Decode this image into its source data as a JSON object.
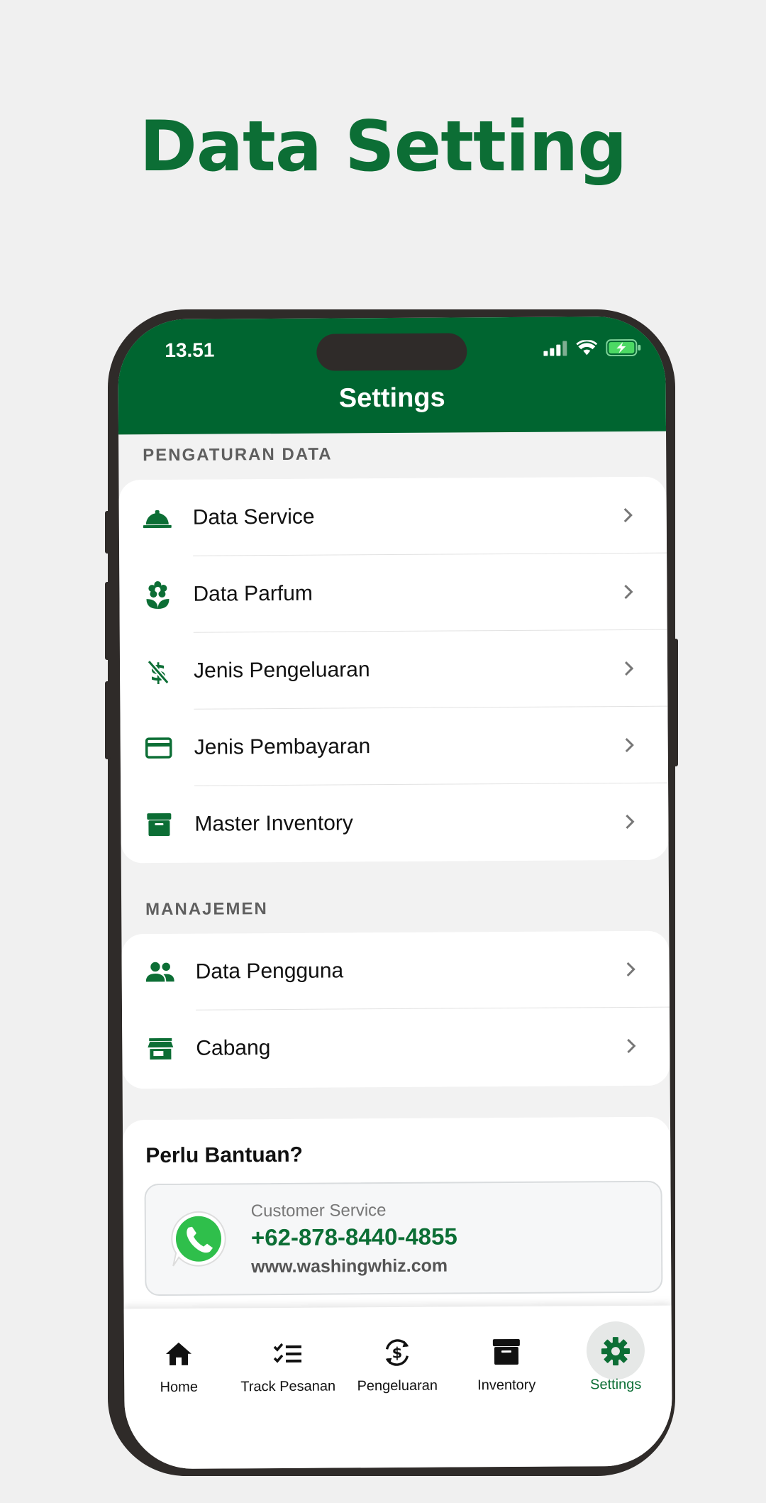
{
  "headline": "Data Setting",
  "status_bar": {
    "time": "13.51"
  },
  "app_bar": {
    "title": "Settings"
  },
  "sections": [
    {
      "label": "PENGATURAN DATA",
      "items": [
        {
          "label": "Data Service",
          "icon": "service-bell-icon"
        },
        {
          "label": "Data Parfum",
          "icon": "flower-icon"
        },
        {
          "label": "Jenis Pengeluaran",
          "icon": "money-off-icon"
        },
        {
          "label": "Jenis Pembayaran",
          "icon": "credit-card-icon"
        },
        {
          "label": "Master Inventory",
          "icon": "archive-box-icon"
        }
      ]
    },
    {
      "label": "MANAJEMEN",
      "items": [
        {
          "label": "Data Pengguna",
          "icon": "people-icon"
        },
        {
          "label": "Cabang",
          "icon": "store-icon"
        }
      ]
    }
  ],
  "help": {
    "title": "Perlu Bantuan?",
    "caption": "Customer Service",
    "phone": "+62-878-8440-4855",
    "website": "www.washingwhiz.com"
  },
  "bottom_nav": [
    {
      "label": "Home",
      "icon": "home-icon"
    },
    {
      "label": "Track Pesanan",
      "icon": "checklist-icon"
    },
    {
      "label": "Pengeluaran",
      "icon": "currency-exchange-icon"
    },
    {
      "label": "Inventory",
      "icon": "inventory-box-icon"
    },
    {
      "label": "Settings",
      "icon": "gear-icon",
      "active": true
    }
  ],
  "colors": {
    "brand_green": "#006530",
    "accent_green": "#0c6e35"
  }
}
